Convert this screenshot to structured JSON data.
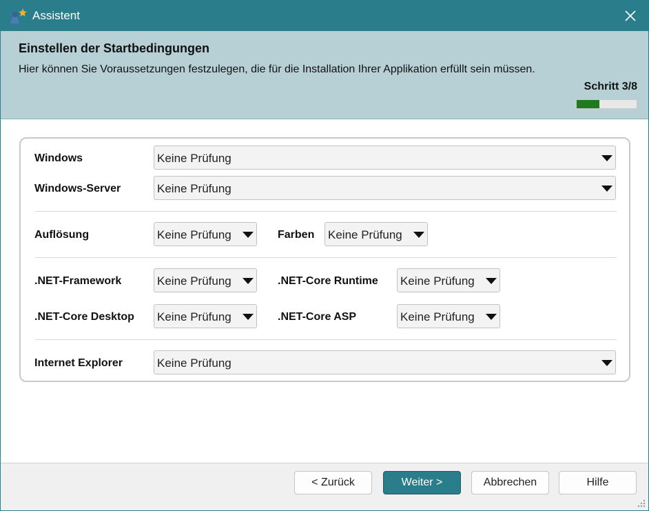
{
  "window": {
    "title": "Assistent"
  },
  "header": {
    "title": "Einstellen der Startbedingungen",
    "description": "Hier können Sie Voraussetzungen festzulegen, die für die Installation Ihrer Applikation erfüllt sein müssen.",
    "step_label": "Schritt 3/8",
    "step_progress": 0.375
  },
  "conditions": {
    "windows": {
      "label": "Windows",
      "value": "Keine Prüfung"
    },
    "windows_server": {
      "label": "Windows-Server",
      "value": "Keine Prüfung"
    },
    "resolution": {
      "label": "Auflösung",
      "value": "Keine Prüfung"
    },
    "colors": {
      "label": "Farben",
      "value": "Keine Prüfung"
    },
    "net_framework": {
      "label": ".NET-Framework",
      "value": "Keine Prüfung"
    },
    "net_core_runtime": {
      "label": ".NET-Core Runtime",
      "value": "Keine Prüfung"
    },
    "net_core_desktop": {
      "label": ".NET-Core Desktop",
      "value": "Keine Prüfung"
    },
    "net_core_asp": {
      "label": ".NET-Core ASP",
      "value": "Keine Prüfung"
    },
    "internet_explorer": {
      "label": "Internet Explorer",
      "value": "Keine Prüfung"
    }
  },
  "buttons": {
    "back": "< Zurück",
    "next": "Weiter >",
    "cancel": "Abbrechen",
    "help": "Hilfe"
  },
  "colors": {
    "accent": "#2a7d8a",
    "header_bg": "#b6d0d5",
    "progress": "#1f7a1f"
  }
}
